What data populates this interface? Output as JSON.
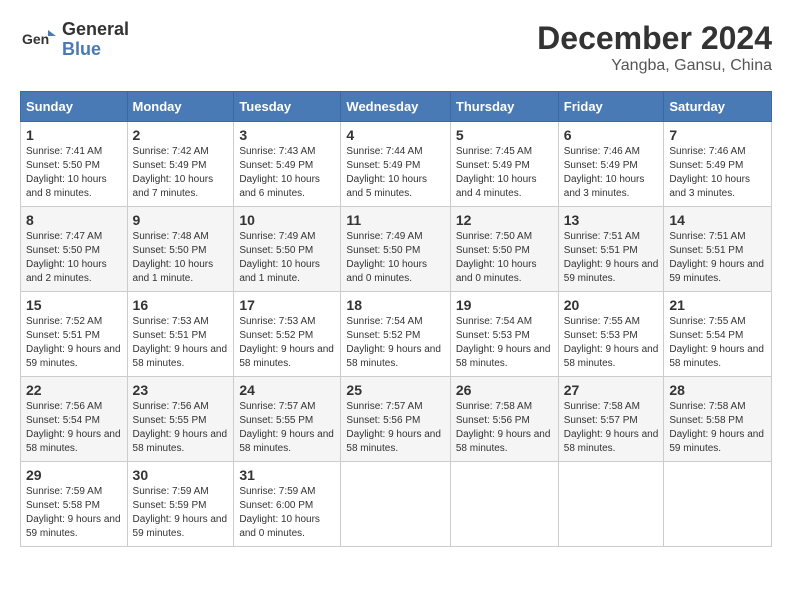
{
  "logo": {
    "line1": "General",
    "line2": "Blue"
  },
  "title": "December 2024",
  "subtitle": "Yangba, Gansu, China",
  "days_of_week": [
    "Sunday",
    "Monday",
    "Tuesday",
    "Wednesday",
    "Thursday",
    "Friday",
    "Saturday"
  ],
  "weeks": [
    [
      {
        "day": "1",
        "sunrise": "7:41 AM",
        "sunset": "5:50 PM",
        "daylight": "10 hours and 8 minutes."
      },
      {
        "day": "2",
        "sunrise": "7:42 AM",
        "sunset": "5:49 PM",
        "daylight": "10 hours and 7 minutes."
      },
      {
        "day": "3",
        "sunrise": "7:43 AM",
        "sunset": "5:49 PM",
        "daylight": "10 hours and 6 minutes."
      },
      {
        "day": "4",
        "sunrise": "7:44 AM",
        "sunset": "5:49 PM",
        "daylight": "10 hours and 5 minutes."
      },
      {
        "day": "5",
        "sunrise": "7:45 AM",
        "sunset": "5:49 PM",
        "daylight": "10 hours and 4 minutes."
      },
      {
        "day": "6",
        "sunrise": "7:46 AM",
        "sunset": "5:49 PM",
        "daylight": "10 hours and 3 minutes."
      },
      {
        "day": "7",
        "sunrise": "7:46 AM",
        "sunset": "5:49 PM",
        "daylight": "10 hours and 3 minutes."
      }
    ],
    [
      {
        "day": "8",
        "sunrise": "7:47 AM",
        "sunset": "5:50 PM",
        "daylight": "10 hours and 2 minutes."
      },
      {
        "day": "9",
        "sunrise": "7:48 AM",
        "sunset": "5:50 PM",
        "daylight": "10 hours and 1 minute."
      },
      {
        "day": "10",
        "sunrise": "7:49 AM",
        "sunset": "5:50 PM",
        "daylight": "10 hours and 1 minute."
      },
      {
        "day": "11",
        "sunrise": "7:49 AM",
        "sunset": "5:50 PM",
        "daylight": "10 hours and 0 minutes."
      },
      {
        "day": "12",
        "sunrise": "7:50 AM",
        "sunset": "5:50 PM",
        "daylight": "10 hours and 0 minutes."
      },
      {
        "day": "13",
        "sunrise": "7:51 AM",
        "sunset": "5:51 PM",
        "daylight": "9 hours and 59 minutes."
      },
      {
        "day": "14",
        "sunrise": "7:51 AM",
        "sunset": "5:51 PM",
        "daylight": "9 hours and 59 minutes."
      }
    ],
    [
      {
        "day": "15",
        "sunrise": "7:52 AM",
        "sunset": "5:51 PM",
        "daylight": "9 hours and 59 minutes."
      },
      {
        "day": "16",
        "sunrise": "7:53 AM",
        "sunset": "5:51 PM",
        "daylight": "9 hours and 58 minutes."
      },
      {
        "day": "17",
        "sunrise": "7:53 AM",
        "sunset": "5:52 PM",
        "daylight": "9 hours and 58 minutes."
      },
      {
        "day": "18",
        "sunrise": "7:54 AM",
        "sunset": "5:52 PM",
        "daylight": "9 hours and 58 minutes."
      },
      {
        "day": "19",
        "sunrise": "7:54 AM",
        "sunset": "5:53 PM",
        "daylight": "9 hours and 58 minutes."
      },
      {
        "day": "20",
        "sunrise": "7:55 AM",
        "sunset": "5:53 PM",
        "daylight": "9 hours and 58 minutes."
      },
      {
        "day": "21",
        "sunrise": "7:55 AM",
        "sunset": "5:54 PM",
        "daylight": "9 hours and 58 minutes."
      }
    ],
    [
      {
        "day": "22",
        "sunrise": "7:56 AM",
        "sunset": "5:54 PM",
        "daylight": "9 hours and 58 minutes."
      },
      {
        "day": "23",
        "sunrise": "7:56 AM",
        "sunset": "5:55 PM",
        "daylight": "9 hours and 58 minutes."
      },
      {
        "day": "24",
        "sunrise": "7:57 AM",
        "sunset": "5:55 PM",
        "daylight": "9 hours and 58 minutes."
      },
      {
        "day": "25",
        "sunrise": "7:57 AM",
        "sunset": "5:56 PM",
        "daylight": "9 hours and 58 minutes."
      },
      {
        "day": "26",
        "sunrise": "7:58 AM",
        "sunset": "5:56 PM",
        "daylight": "9 hours and 58 minutes."
      },
      {
        "day": "27",
        "sunrise": "7:58 AM",
        "sunset": "5:57 PM",
        "daylight": "9 hours and 58 minutes."
      },
      {
        "day": "28",
        "sunrise": "7:58 AM",
        "sunset": "5:58 PM",
        "daylight": "9 hours and 59 minutes."
      }
    ],
    [
      {
        "day": "29",
        "sunrise": "7:59 AM",
        "sunset": "5:58 PM",
        "daylight": "9 hours and 59 minutes."
      },
      {
        "day": "30",
        "sunrise": "7:59 AM",
        "sunset": "5:59 PM",
        "daylight": "9 hours and 59 minutes."
      },
      {
        "day": "31",
        "sunrise": "7:59 AM",
        "sunset": "6:00 PM",
        "daylight": "10 hours and 0 minutes."
      },
      null,
      null,
      null,
      null
    ]
  ]
}
